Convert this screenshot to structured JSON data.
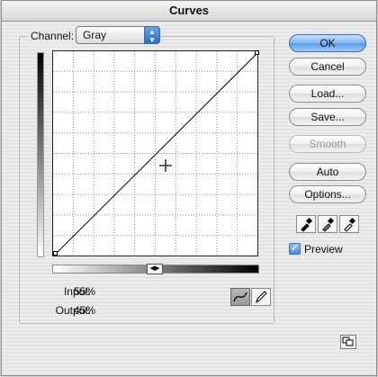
{
  "window": {
    "title": "Curves"
  },
  "channel": {
    "label": "Channel:",
    "value": "Gray"
  },
  "readout": {
    "input_label": "Input:",
    "input_value": "55%",
    "output_label": "Output:",
    "output_value": "45%"
  },
  "buttons": {
    "ok": "OK",
    "cancel": "Cancel",
    "load": "Load...",
    "save": "Save...",
    "smooth": "Smooth",
    "auto": "Auto",
    "options": "Options..."
  },
  "preview": {
    "label": "Preview",
    "checked": true
  },
  "colors": {
    "accent": "#5a9be6",
    "grid": "#777777",
    "curve": "#000000"
  },
  "icons": [
    "updown-arrows-icon",
    "curve-tool-icon",
    "pencil-tool-icon",
    "black-eyedropper-icon",
    "gray-eyedropper-icon",
    "white-eyedropper-icon",
    "gradient-toggle-icon",
    "expand-window-icon",
    "crosshair-cursor-icon"
  ]
}
